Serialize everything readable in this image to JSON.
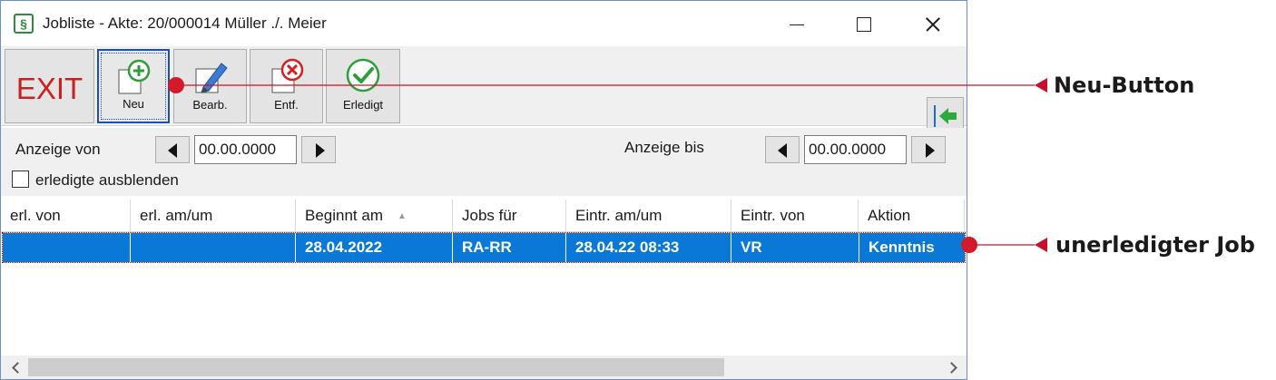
{
  "window": {
    "title": "Jobliste - Akte: 20/000014  Müller ./. Meier",
    "app_icon_glyph": "§"
  },
  "toolbar": {
    "exit_label": "EXIT",
    "new_label": "Neu",
    "edit_label": "Bearb.",
    "delete_label": "Entf.",
    "done_label": "Erledigt"
  },
  "filter": {
    "from_label": "Anzeige von",
    "from_value": "00.00.0000",
    "to_label": "Anzeige bis",
    "to_value": "00.00.0000",
    "hide_done_label": "erledigte ausblenden"
  },
  "grid": {
    "columns": [
      "erl. von",
      "erl. am/um",
      "Beginnt am",
      "Jobs für",
      "Eintr. am/um",
      "Eintr. von",
      "Aktion"
    ],
    "rows": [
      [
        "",
        "",
        "28.04.2022",
        "RA-RR",
        "28.04.22 08:33",
        "VR",
        "Kenntnis"
      ]
    ]
  },
  "annotations": {
    "new_button": "Neu-Button",
    "open_job": "unerledigter Job"
  },
  "colors": {
    "selection": "#0a78d7",
    "exit_red": "#cc1f1f",
    "annotation_red": "#c8102e",
    "accent_green": "#2e9e3a"
  }
}
